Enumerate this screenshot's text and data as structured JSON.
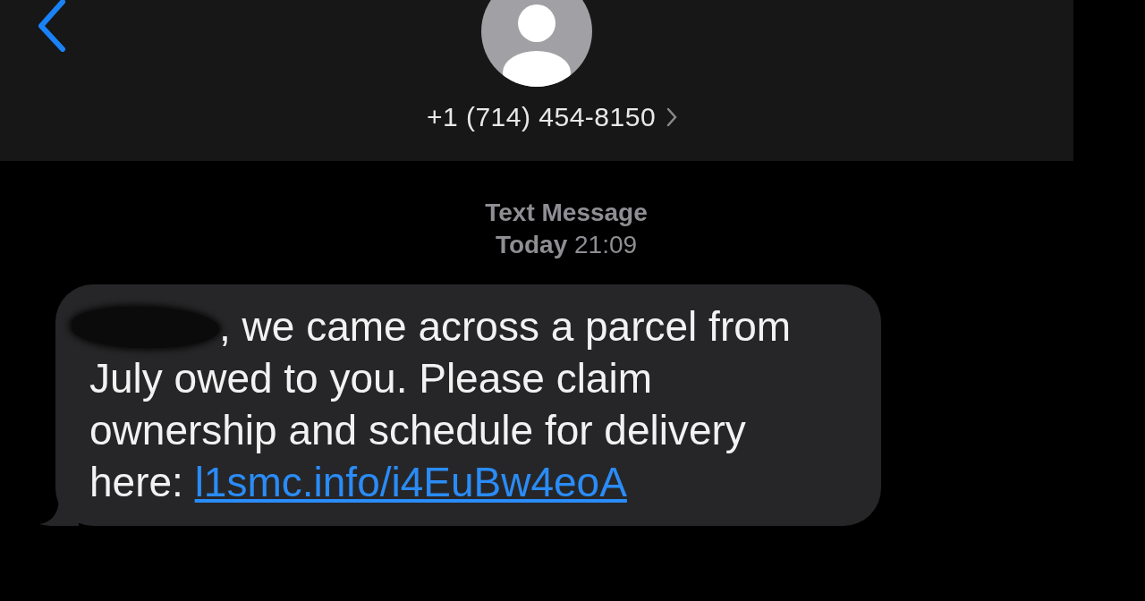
{
  "header": {
    "contact": "+1 (714) 454-8150"
  },
  "conversation": {
    "service": "Text Message",
    "timestamp": "**Today** 21:09",
    "messages": [
      {
        "kind": "incoming",
        "redacted": true,
        "text": ", we came across a parcel from July owed to you. Please claim ownership and schedule for delivery here: ",
        "link": "l1smc.info/i4EuBw4eoA"
      }
    ]
  }
}
